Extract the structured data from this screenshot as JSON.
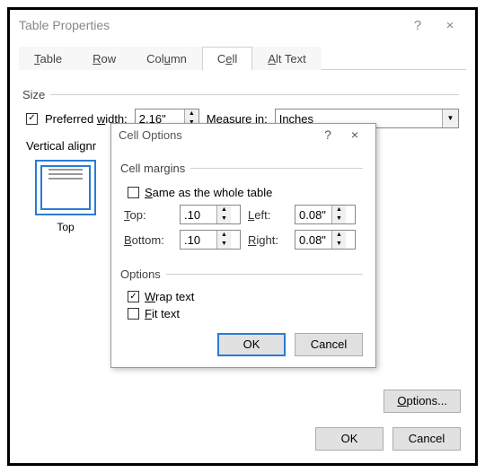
{
  "dialog": {
    "title": "Table Properties",
    "help_icon": "?",
    "close_icon": "×",
    "tabs": {
      "table": "Table",
      "row": "Row",
      "column": "Column",
      "cell": "Cell",
      "alttext": "Alt Text"
    },
    "size": {
      "legend": "Size",
      "preferred_width_label": "Preferred width:",
      "preferred_width_value": "2.16\"",
      "measure_in_label": "Measure in:",
      "measure_in_value": "Inches"
    },
    "valign": {
      "legend_partial": "Vertical alignr",
      "top_label": "Top"
    },
    "options_button": "Options...",
    "ok": "OK",
    "cancel": "Cancel"
  },
  "cell_options": {
    "title": "Cell Options",
    "help_icon": "?",
    "close_icon": "×",
    "margins_legend": "Cell margins",
    "same_as_table": "Same as the whole table",
    "top_label": "Top:",
    "top_value": ".10",
    "bottom_label": "Bottom:",
    "bottom_value": ".10",
    "left_label": "Left:",
    "left_value": "0.08\"",
    "right_label": "Right:",
    "right_value": "0.08\"",
    "options_legend": "Options",
    "wrap_text": "Wrap text",
    "fit_text": "Fit text",
    "ok": "OK",
    "cancel": "Cancel"
  }
}
